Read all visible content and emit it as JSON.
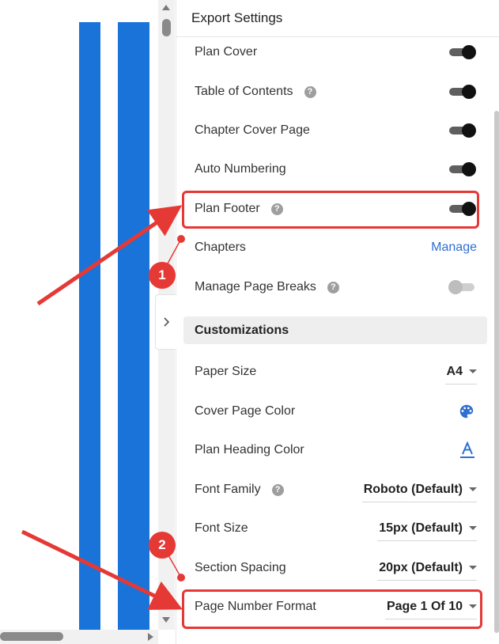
{
  "panel": {
    "title": "Export Settings"
  },
  "toggles": [
    {
      "label": "Plan Cover",
      "help": false,
      "on": true
    },
    {
      "label": "Table of Contents",
      "help": true,
      "on": true
    },
    {
      "label": "Chapter Cover Page",
      "help": false,
      "on": true
    },
    {
      "label": "Auto Numbering",
      "help": false,
      "on": true
    },
    {
      "label": "Plan Footer",
      "help": true,
      "on": true
    }
  ],
  "chapters": {
    "label": "Chapters",
    "action": "Manage"
  },
  "page_breaks": {
    "label": "Manage Page Breaks",
    "help": true,
    "on": false
  },
  "customizations": {
    "title": "Customizations",
    "paper_size": {
      "label": "Paper Size",
      "value": "A4"
    },
    "cover_color": {
      "label": "Cover Page Color",
      "icon": "palette-icon"
    },
    "heading_color": {
      "label": "Plan Heading Color",
      "icon": "text-color-icon"
    },
    "font_family": {
      "label": "Font Family",
      "value": "Roboto (Default)",
      "help": true
    },
    "font_size": {
      "label": "Font Size",
      "value": "15px (Default)"
    },
    "section_spacing": {
      "label": "Section Spacing",
      "value": "20px (Default)"
    },
    "page_number_format": {
      "label": "Page Number Format",
      "value": "Page 1 Of 10"
    }
  },
  "annotations": {
    "badge1": "1",
    "badge2": "2"
  },
  "colors": {
    "accent": "#1a73d9",
    "link": "#2f6fd1",
    "highlight": "#e53935"
  },
  "help_glyph": "?"
}
